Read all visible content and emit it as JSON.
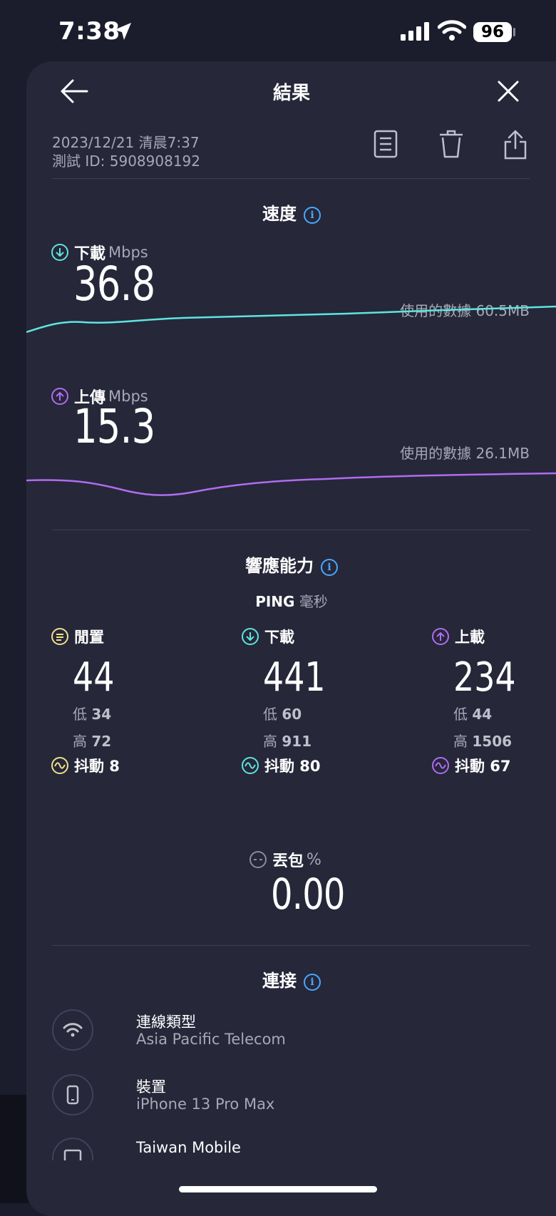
{
  "status": {
    "time": "7:38",
    "battery": "96"
  },
  "header": {
    "title": "結果"
  },
  "meta": {
    "datetime": "2023/12/21 清晨7:37",
    "test_id": "測試 ID: 5908908192"
  },
  "speed": {
    "title": "速度",
    "download": {
      "label": "下載",
      "unit": "Mbps",
      "value": "36.8",
      "data_used": "使用的數據 60.5MB",
      "color": "#5ee5e0"
    },
    "upload": {
      "label": "上傳",
      "unit": "Mbps",
      "value": "15.3",
      "data_used": "使用的數據 26.1MB",
      "color": "#b06cf0"
    }
  },
  "responsiveness": {
    "title": "響應能力",
    "ping_label": "PING",
    "ping_unit": "毫秒",
    "idle": {
      "label": "閒置",
      "value": "44",
      "low_label": "低",
      "low": "34",
      "high_label": "高",
      "high": "72",
      "jitter": "抖動 8",
      "color": "#f1e08a"
    },
    "download": {
      "label": "下載",
      "value": "441",
      "low_label": "低",
      "low": "60",
      "high_label": "高",
      "high": "911",
      "jitter": "抖動 80",
      "color": "#5ee5e0"
    },
    "upload": {
      "label": "上載",
      "value": "234",
      "low_label": "低",
      "low": "44",
      "high_label": "高",
      "high": "1506",
      "jitter": "抖動 67",
      "color": "#b06cf0"
    }
  },
  "packet_loss": {
    "label": "丟包",
    "unit": "%",
    "value": "0.00"
  },
  "connection": {
    "title": "連接",
    "items": [
      {
        "title": "連線類型",
        "value": "Asia Pacific Telecom"
      },
      {
        "title": "裝置",
        "value": "iPhone 13 Pro Max"
      },
      {
        "title": "Taiwan Mobile",
        "value": ""
      }
    ]
  }
}
